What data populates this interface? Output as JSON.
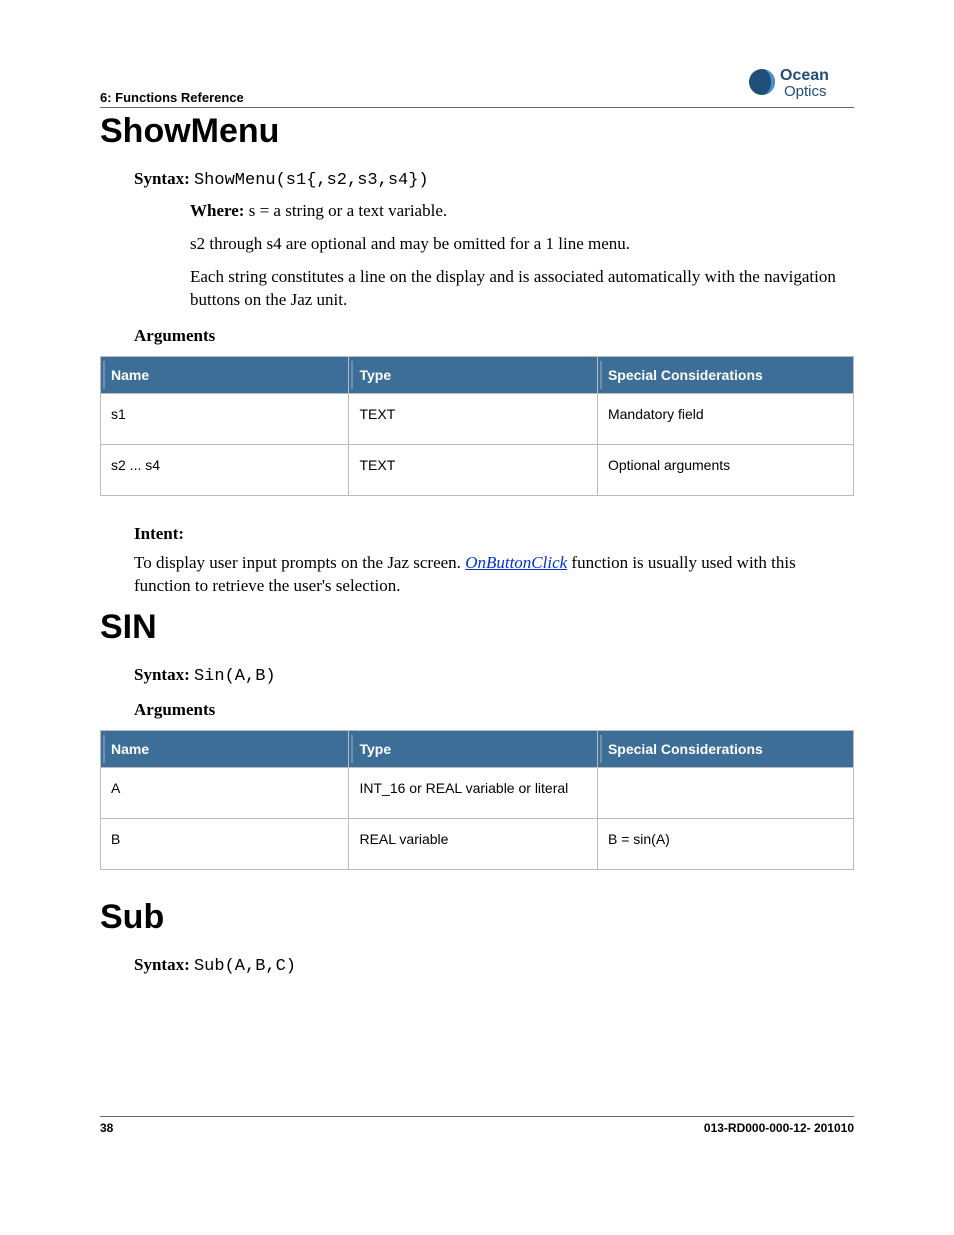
{
  "header": {
    "section_label": "6: Functions Reference",
    "logo_text_top": "Ocean",
    "logo_text_bottom": "Optics"
  },
  "showmenu": {
    "title": "ShowMenu",
    "syntax_label": "Syntax: ",
    "syntax_code": "ShowMenu(s1{,s2,s3,s4})",
    "where_label": "Where: ",
    "where_text": "s = a string or a text variable.",
    "para1": "s2 through s4 are optional and may be omitted for a 1 line menu.",
    "para2": "Each string constitutes a line on the display and is associated automatically with the navigation buttons on the Jaz unit.",
    "arguments_label": "Arguments",
    "table": {
      "headers": {
        "name": "Name",
        "type": "Type",
        "spec": "Special Considerations"
      },
      "rows": [
        {
          "name": "s1",
          "type": "TEXT",
          "spec": "Mandatory field"
        },
        {
          "name": "s2 ... s4",
          "type": "TEXT",
          "spec": "Optional arguments"
        }
      ]
    },
    "intent_label": "Intent:",
    "intent_text_pre": "To display user input prompts on the Jaz screen. ",
    "intent_link": "OnButtonClick",
    "intent_text_post": " function is usually used with this function to retrieve the user's selection."
  },
  "sin": {
    "title": "SIN",
    "syntax_label": "Syntax: ",
    "syntax_code": "Sin(A,B)",
    "arguments_label": "Arguments",
    "table": {
      "headers": {
        "name": "Name",
        "type": "Type",
        "spec": "Special Considerations"
      },
      "rows": [
        {
          "name": "A",
          "type": "INT_16 or REAL variable or literal",
          "spec": ""
        },
        {
          "name": "B",
          "type": "REAL variable",
          "spec": "B = sin(A)"
        }
      ]
    }
  },
  "sub": {
    "title": "Sub",
    "syntax_label": "Syntax: ",
    "syntax_code": "Sub(A,B,C)"
  },
  "footer": {
    "page_number": "38",
    "doc_id": "013-RD000-000-12- 201010"
  }
}
